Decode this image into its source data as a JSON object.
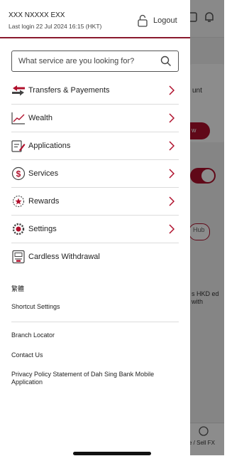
{
  "header": {
    "user_name": "XXX NXXXX EXX",
    "last_login": "Last login 22 Jul 2024 16:15 (HKT)",
    "logout_label": "Logout"
  },
  "search": {
    "placeholder": "What service are you looking for?"
  },
  "menu": [
    {
      "label": "Transfers & Payements",
      "icon": "transfer-icon"
    },
    {
      "label": "Wealth",
      "icon": "chart-line-icon"
    },
    {
      "label": "Applications",
      "icon": "form-pen-icon"
    },
    {
      "label": "Services",
      "icon": "dollar-circle-icon"
    },
    {
      "label": "Rewards",
      "icon": "reward-star-icon"
    },
    {
      "label": "Settings",
      "icon": "gear-icon"
    },
    {
      "label": "Cardless Withdrawal",
      "icon": "atm-icon"
    }
  ],
  "links": {
    "language": "繁體",
    "shortcut_settings": "Shortcut Settings",
    "branch_locator": "Branch Locator",
    "contact_us": "Contact Us",
    "privacy_policy": "Privacy Policy Statement of Dah Sing Bank Mobile Application"
  },
  "background": {
    "card_text": "unt",
    "pill_text": "w",
    "chip_text": "Hub",
    "hkd_text": "s HKD ed with",
    "tab_text": "e / Sell FX"
  },
  "colors": {
    "accent": "#b0102c",
    "divider": "#8a1a2e"
  }
}
